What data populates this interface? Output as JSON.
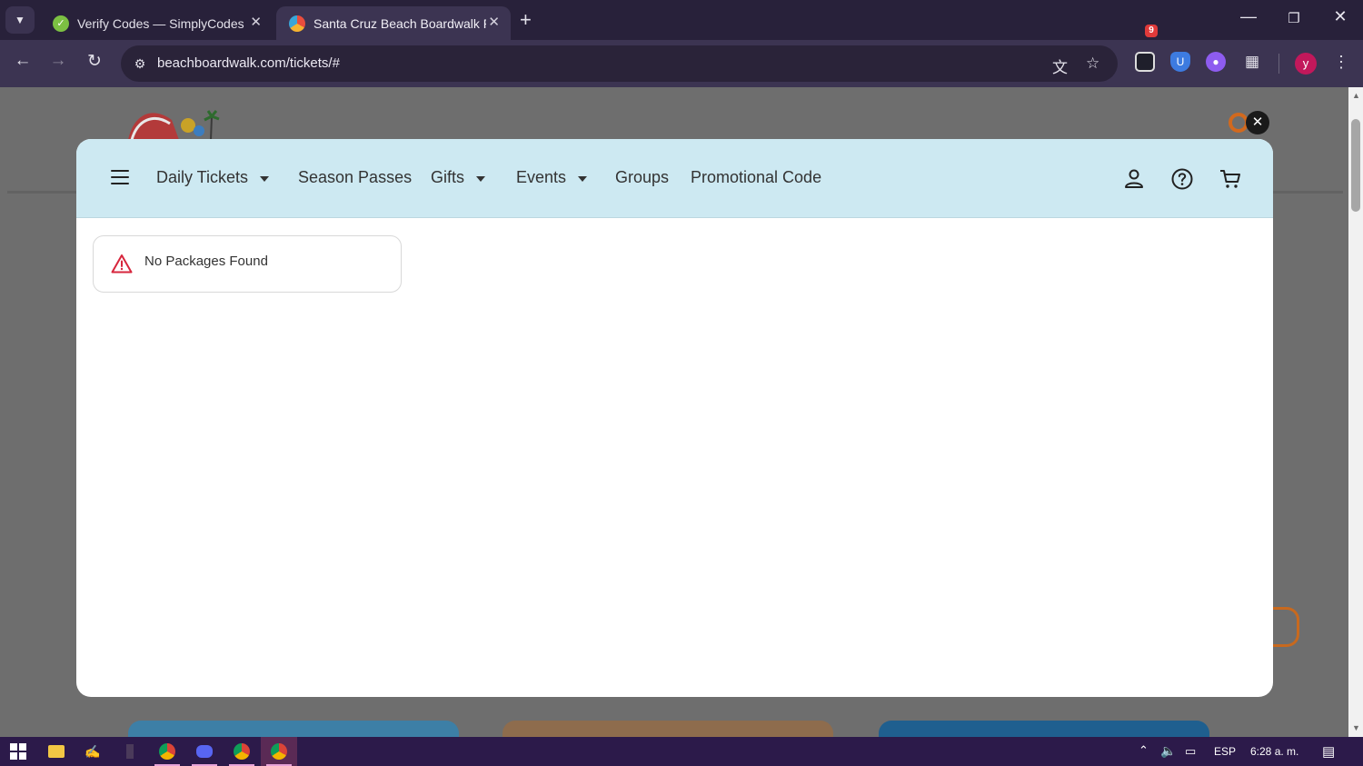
{
  "browser": {
    "tabs": [
      {
        "title": "Verify Codes — SimplyCodes",
        "active": false,
        "favicon": "simplycodes-favicon"
      },
      {
        "title": "Santa Cruz Beach Boardwalk Ri",
        "active": true,
        "favicon": "boardwalk-favicon"
      }
    ],
    "new_tab_symbol": "+",
    "url": "beachboardwalk.com/tickets/#",
    "extension_badge": "9",
    "profile_initial": "y"
  },
  "modal": {
    "nav": {
      "items": [
        {
          "label": "Daily Tickets",
          "dropdown": true
        },
        {
          "label": "Season Passes",
          "dropdown": false
        },
        {
          "label": "Gifts",
          "dropdown": true
        },
        {
          "label": "Events",
          "dropdown": true
        },
        {
          "label": "Groups",
          "dropdown": false
        },
        {
          "label": "Promotional Code",
          "dropdown": false
        }
      ],
      "icons": [
        "account-icon",
        "help-icon",
        "cart-icon"
      ]
    },
    "alert": {
      "message": "No Packages Found",
      "icon": "warning-triangle-icon",
      "icon_color": "#d7263d"
    },
    "nav_background": "#cde9f2"
  },
  "taskbar": {
    "language": "ESP",
    "clock": "6:28 a. m."
  },
  "colors": {
    "accent_orange": "#d2691e",
    "browser_frame": "#28213a",
    "taskbar": "#2c1a4a"
  }
}
